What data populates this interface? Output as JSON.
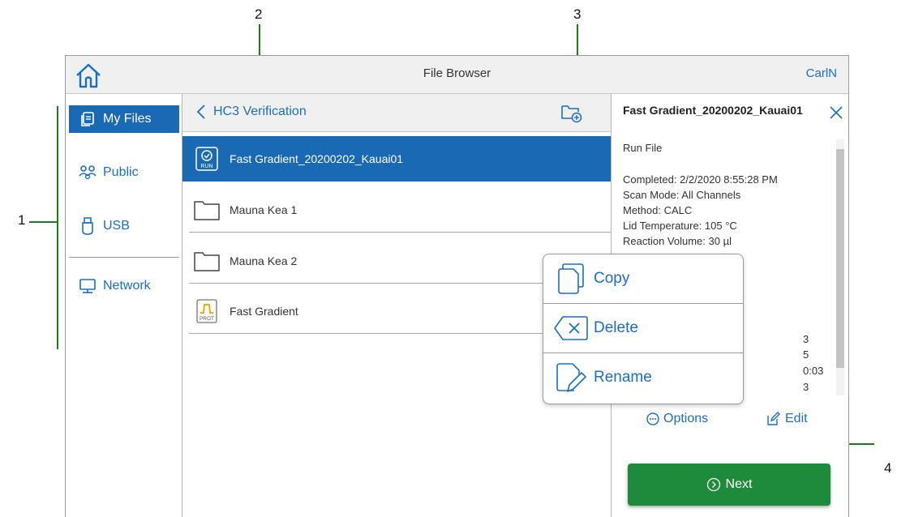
{
  "callouts": [
    "1",
    "2",
    "3",
    "4"
  ],
  "titlebar": {
    "title": "File Browser",
    "user": "CarlN"
  },
  "nav": {
    "items": [
      {
        "label": "My Files",
        "icon": "files-icon"
      },
      {
        "label": "Public",
        "icon": "people-icon"
      },
      {
        "label": "USB",
        "icon": "usb-icon"
      },
      {
        "label": "Network",
        "icon": "network-icon"
      }
    ],
    "active": "My Files"
  },
  "filelist": {
    "folder": "HC3 Verification",
    "rows": [
      {
        "name": "Fast Gradient_20200202_Kauai01",
        "type": "run",
        "badge": "RUN"
      },
      {
        "name": "Mauna Kea 1",
        "type": "folder"
      },
      {
        "name": "Mauna Kea 2",
        "type": "folder"
      },
      {
        "name": "Fast Gradient",
        "type": "protocol",
        "badge": "PROT"
      }
    ]
  },
  "details": {
    "name": "Fast Gradient_20200202_Kauai01",
    "type": "Run File",
    "properties": [
      "Completed: 2/2/2020 8:55:28 PM",
      "Scan Mode: All Channels",
      "Method: CALC",
      "Lid Temperature: 105 °C",
      "Reaction Volume: 30 µl"
    ],
    "partial_values": [
      "3",
      "5",
      "0:03",
      "3"
    ],
    "options_label": "Options",
    "edit_label": "Edit",
    "next_label": "Next"
  },
  "popup": {
    "items": [
      "Copy",
      "Delete",
      "Rename"
    ]
  },
  "colors": {
    "accent": "#1a69b5",
    "link": "#1b6ec2",
    "next": "#1e8b3c",
    "callout_line": "#1e7a1e"
  }
}
